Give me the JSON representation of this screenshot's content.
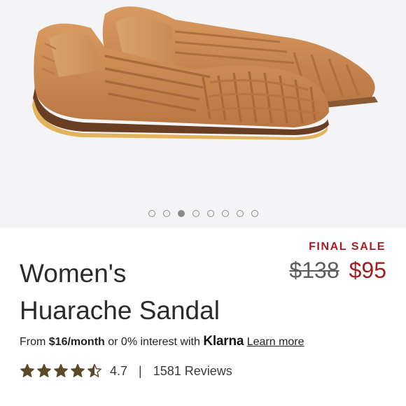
{
  "gallery": {
    "image_alt": "Women's Huarache Sandal product photo",
    "dot_count": 8,
    "active_index": 2
  },
  "badge": {
    "label": "FINAL SALE"
  },
  "product": {
    "title_line1": "Women's",
    "title_line2": "Huarache Sandal",
    "original_price": "$138",
    "sale_price": "$95"
  },
  "financing": {
    "prefix": "From",
    "amount": "$16/month",
    "middle": "or 0% interest with",
    "provider": "Klarna",
    "link": "Learn more"
  },
  "rating": {
    "value": "4.7",
    "stars_filled": 4.5,
    "max_stars": 5,
    "separator": "|",
    "reviews": "1581 Reviews"
  },
  "colors": {
    "accent": "#a01f22",
    "star": "#5b4a2a",
    "leather": "#c98a52"
  }
}
